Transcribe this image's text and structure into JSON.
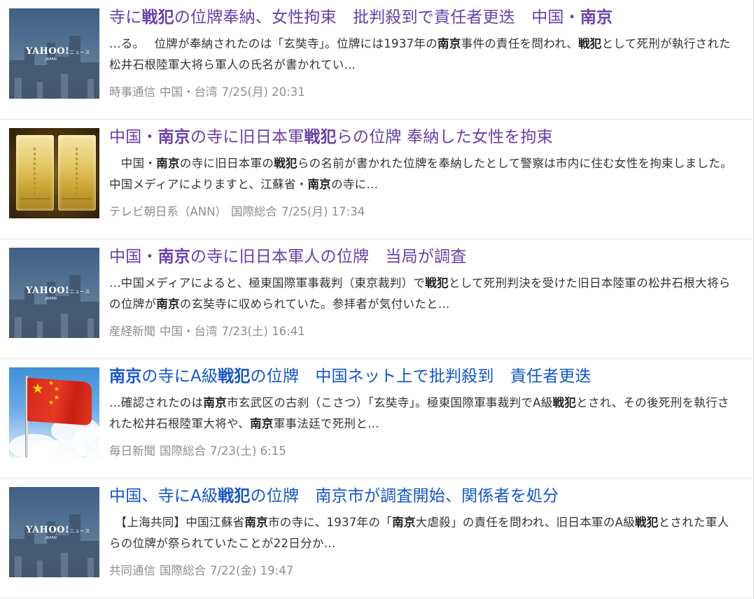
{
  "results": [
    {
      "thumb": "yahoo-news-placeholder",
      "title_style": "visited",
      "title": [
        {
          "t": "寺に",
          "b": false
        },
        {
          "t": "戦犯",
          "b": true
        },
        {
          "t": "の位牌奉納、女性拘束　批判殺到で責任者更迭　中国・",
          "b": false
        },
        {
          "t": "南京",
          "b": true
        }
      ],
      "snippet": [
        {
          "t": "…る。　 位牌が奉納されたのは「玄奘寺」。位牌には1937年の",
          "b": false
        },
        {
          "t": "南京",
          "b": true
        },
        {
          "t": "事件の責任を問われ、",
          "b": false
        },
        {
          "t": "戦犯",
          "b": true
        },
        {
          "t": "として死刑が執行された松井石根陸軍大将ら軍人の氏名が書かれてい…",
          "b": false
        }
      ],
      "source": "時事通信",
      "category": "中国・台湾",
      "date": "7/25(月) 20:31"
    },
    {
      "thumb": "golden-tablets-photo",
      "title_style": "visited",
      "title": [
        {
          "t": "中国・",
          "b": false
        },
        {
          "t": "南京",
          "b": true
        },
        {
          "t": "の寺に旧日本軍",
          "b": false
        },
        {
          "t": "戦犯",
          "b": true
        },
        {
          "t": "らの位牌 奉納した女性を拘束",
          "b": false
        }
      ],
      "snippet": [
        {
          "t": "　中国・",
          "b": false
        },
        {
          "t": "南京",
          "b": true
        },
        {
          "t": "の寺に旧日本軍の",
          "b": false
        },
        {
          "t": "戦犯",
          "b": true
        },
        {
          "t": "らの名前が書かれた位牌を奉納したとして警察は市内に住む女性を拘束しました。　 中国メディアによりますと、江蘇省・",
          "b": false
        },
        {
          "t": "南京",
          "b": true
        },
        {
          "t": "の寺に…",
          "b": false
        }
      ],
      "source": "テレビ朝日系（ANN）",
      "category": "国際総合",
      "date": "7/25(月) 17:34"
    },
    {
      "thumb": "yahoo-news-placeholder",
      "title_style": "visited",
      "title": [
        {
          "t": "中国・",
          "b": false
        },
        {
          "t": "南京",
          "b": true
        },
        {
          "t": "の寺に旧日本軍人の位牌　当局が調査",
          "b": false
        }
      ],
      "snippet": [
        {
          "t": "…中国メディアによると、極東国際軍事裁判（東京裁判）で",
          "b": false
        },
        {
          "t": "戦犯",
          "b": true
        },
        {
          "t": "として死刑判決を受けた旧日本陸軍の松井石根大将らの位牌が",
          "b": false
        },
        {
          "t": "南京",
          "b": true
        },
        {
          "t": "の玄奘寺に収められていた。参拝者が気付いたと…",
          "b": false
        }
      ],
      "source": "産経新聞",
      "category": "中国・台湾",
      "date": "7/23(土) 16:41"
    },
    {
      "thumb": "chinese-flag-photo",
      "title_style": "unvisited",
      "title": [
        {
          "t": "南京",
          "b": true
        },
        {
          "t": "の寺にA級",
          "b": false
        },
        {
          "t": "戦犯",
          "b": true
        },
        {
          "t": "の位牌　中国ネット上で批判殺到　責任者更迭",
          "b": false
        }
      ],
      "snippet": [
        {
          "t": "…確認されたのは",
          "b": false
        },
        {
          "t": "南京",
          "b": true
        },
        {
          "t": "市玄武区の古刹（こさつ）「玄奘寺」。極東国際軍事裁判でA級",
          "b": false
        },
        {
          "t": "戦犯",
          "b": true
        },
        {
          "t": "とされ、その後死刑を執行された松井石根陸軍大将や、",
          "b": false
        },
        {
          "t": "南京",
          "b": true
        },
        {
          "t": "軍事法廷で死刑と…",
          "b": false
        }
      ],
      "source": "毎日新聞",
      "category": "国際総合",
      "date": "7/23(土) 6:15"
    },
    {
      "thumb": "yahoo-news-placeholder",
      "title_style": "unvisited",
      "title": [
        {
          "t": "中国、寺にA級",
          "b": false
        },
        {
          "t": "戦犯",
          "b": true
        },
        {
          "t": "の位牌　南京市が調査開始、関係者を処分",
          "b": false
        }
      ],
      "snippet": [
        {
          "t": "　【上海共同】中国江蘇省",
          "b": false
        },
        {
          "t": "南京",
          "b": true
        },
        {
          "t": "市の寺に、1937年の「",
          "b": false
        },
        {
          "t": "南京",
          "b": true
        },
        {
          "t": "大虐殺」の責任を問われ、旧日本軍のA級",
          "b": false
        },
        {
          "t": "戦犯",
          "b": true
        },
        {
          "t": "とされた軍人らの位牌が祭られていたことが22日分か…",
          "b": false
        }
      ],
      "source": "共同通信",
      "category": "国際総合",
      "date": "7/22(金) 19:47"
    }
  ],
  "yahoo_logo_text": "YAHOO!",
  "yahoo_logo_suffix": "ニュース",
  "yahoo_logo_sub": "JAPAN",
  "colors": {
    "title_visited": "#6a3fa6",
    "title_unvisited": "#1556c5",
    "snippet": "#333333",
    "meta": "#8e8e8e"
  }
}
